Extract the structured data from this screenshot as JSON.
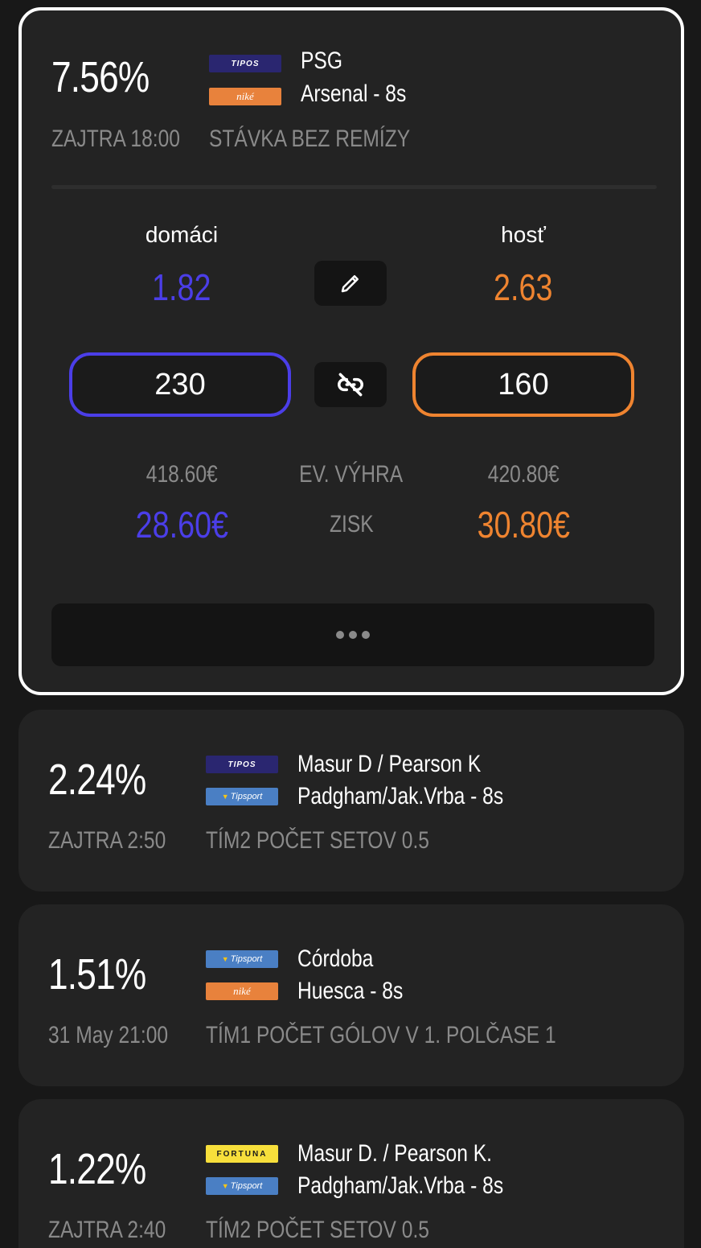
{
  "cards": [
    {
      "percent": "7.56%",
      "time": "ZAJTRA 18:00",
      "market": "STÁVKA BEZ REMÍZY",
      "bookmakers": [
        {
          "name": "TIPOS",
          "team": "PSG"
        },
        {
          "name": "niké",
          "team": "Arsenal - 8s"
        }
      ],
      "expanded": {
        "home_label": "domáci",
        "away_label": "hosť",
        "home_odds": "1.82",
        "away_odds": "2.63",
        "home_stake": "230",
        "away_stake": "160",
        "home_return": "418.60€",
        "away_return": "420.80€",
        "return_label": "EV. VÝHRA",
        "profit_label": "ZISK",
        "home_profit": "28.60€",
        "away_profit": "30.80€",
        "edit_icon": "pencil-icon",
        "link_icon": "unlink-icon",
        "more_icon": "ellipsis-icon"
      }
    },
    {
      "percent": "2.24%",
      "time": "ZAJTRA 2:50",
      "market": "TÍM2 POČET SETOV 0.5",
      "bookmakers": [
        {
          "name": "TIPOS",
          "team": "Masur D / Pearson K"
        },
        {
          "name": "Tipsport",
          "team": "Padgham/Jak.Vrba - 8s"
        }
      ]
    },
    {
      "percent": "1.51%",
      "time": "31 May 21:00",
      "market": "TÍM1 POČET GÓLOV V 1. POLČASE 1",
      "bookmakers": [
        {
          "name": "Tipsport",
          "team": "Córdoba"
        },
        {
          "name": "niké",
          "team": "Huesca - 8s"
        }
      ]
    },
    {
      "percent": "1.22%",
      "time": "ZAJTRA 2:40",
      "market": "TÍM2 POČET SETOV 0.5",
      "bookmakers": [
        {
          "name": "FORTUNA",
          "team": "Masur D. / Pearson K."
        },
        {
          "name": "Tipsport",
          "team": "Padgham/Jak.Vrba - 8s"
        }
      ]
    }
  ],
  "colors": {
    "home": "#4b3ee8",
    "away": "#ef8430",
    "card": "#232323",
    "background": "#181818"
  }
}
